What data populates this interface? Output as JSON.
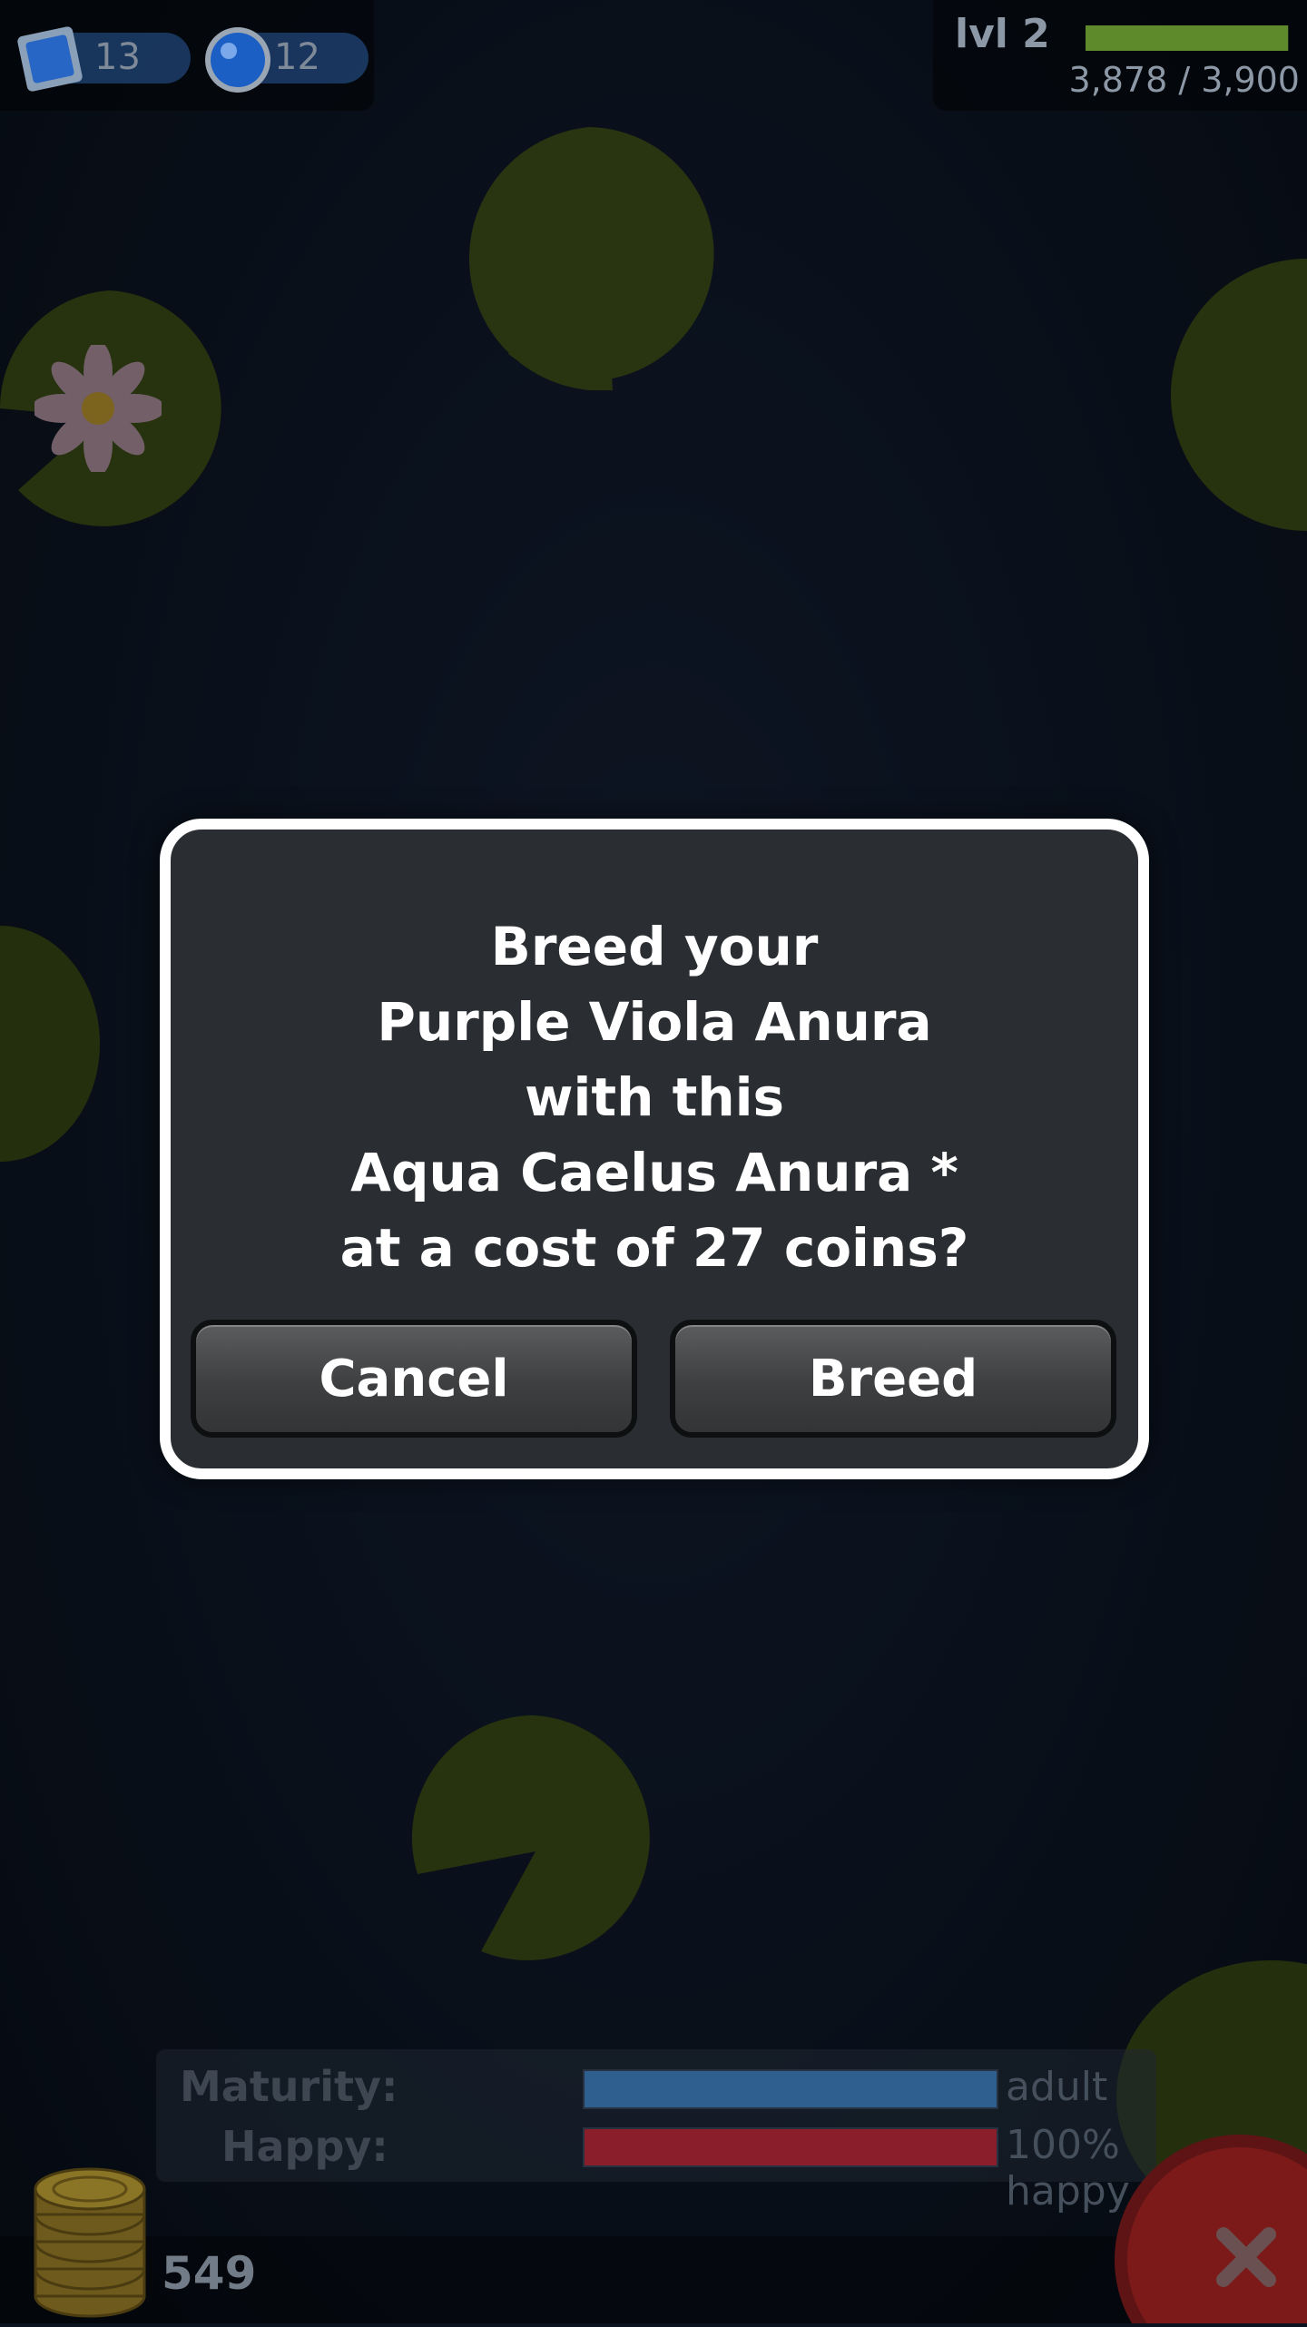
{
  "hud": {
    "stamps_count": "13",
    "gems_count": "12",
    "level_label": "lvl 2",
    "xp_text": "3,878 / 3,900",
    "xp_fraction": 0.9949
  },
  "dialog": {
    "lines": [
      "Breed your",
      "Purple Viola Anura",
      "with this",
      "Aqua Caelus Anura *",
      "at a cost of 27 coins?"
    ],
    "cancel_label": "Cancel",
    "confirm_label": "Breed"
  },
  "stats": {
    "maturity_label": "Maturity:",
    "maturity_value": "adult",
    "maturity_fraction": 1.0,
    "happy_label": "Happy:",
    "happy_value": "100% happy",
    "happy_fraction": 1.0
  },
  "coins": {
    "count": "549"
  },
  "colors": {
    "dialog_bg": "#2a2e32",
    "dialog_border": "#ffffff",
    "xp_fill": "#5e8a2c",
    "maturity_fill": "#2f5f8f",
    "happy_fill": "#8a1e2a",
    "close_button": "#b82424"
  },
  "icons": {
    "stamp": "stamp-icon",
    "gem": "gem-icon",
    "coins": "coins-stack-icon",
    "close": "close-icon"
  }
}
